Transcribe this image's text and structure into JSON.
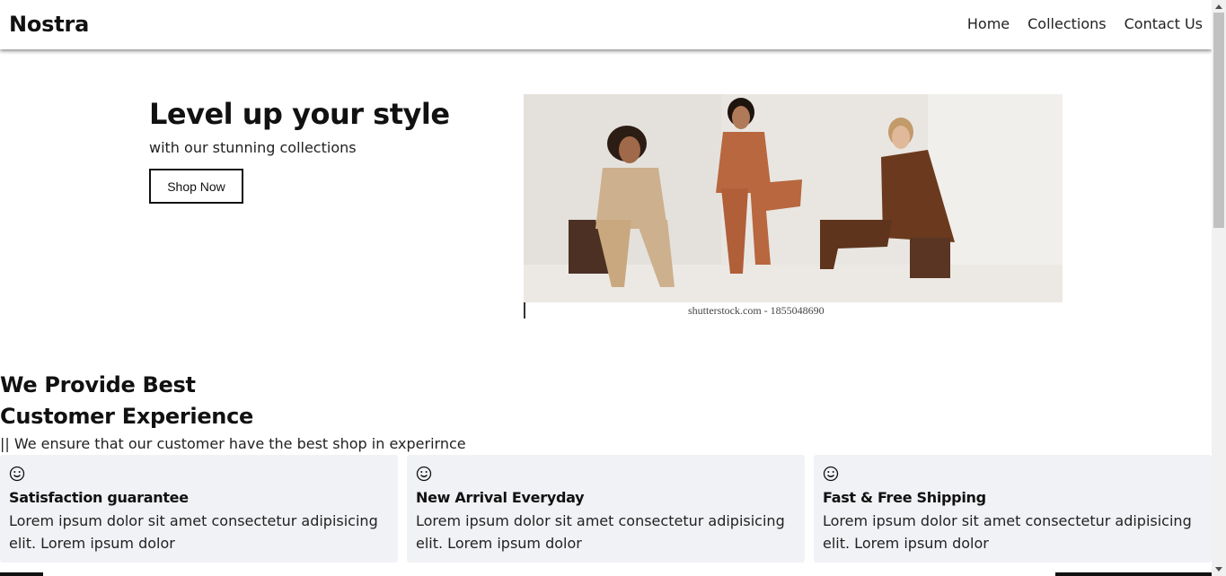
{
  "header": {
    "brand": "Nostra",
    "nav": [
      "Home",
      "Collections",
      "Contact Us"
    ]
  },
  "hero": {
    "title": "Level up your style",
    "subtitle": "with our stunning collections",
    "button_label": "Shop Now",
    "image_watermark": "shutterstock.com - 1855048690"
  },
  "features": {
    "title_line1": "We Provide Best",
    "title_line2": "Customer Experience",
    "description": "|| We ensure that our customer have the best shop in experirnce",
    "cards": [
      {
        "icon": "smile-icon",
        "title": "Satisfaction guarantee",
        "text": "Lorem ipsum dolor sit amet consectetur adipisicing elit. Lorem ipsum dolor"
      },
      {
        "icon": "smile-icon",
        "title": "New Arrival Everyday",
        "text": "Lorem ipsum dolor sit amet consectetur adipisicing elit. Lorem ipsum dolor"
      },
      {
        "icon": "smile-icon",
        "title": "Fast & Free Shipping",
        "text": "Lorem ipsum dolor sit amet consectetur adipisicing elit. Lorem ipsum dolor"
      }
    ]
  },
  "colors": {
    "card_bg": "#f1f2f5",
    "text": "#111111",
    "suit_beige": "#c9a880",
    "suit_rust": "#b8673f",
    "suit_brown": "#6b3a1e"
  }
}
